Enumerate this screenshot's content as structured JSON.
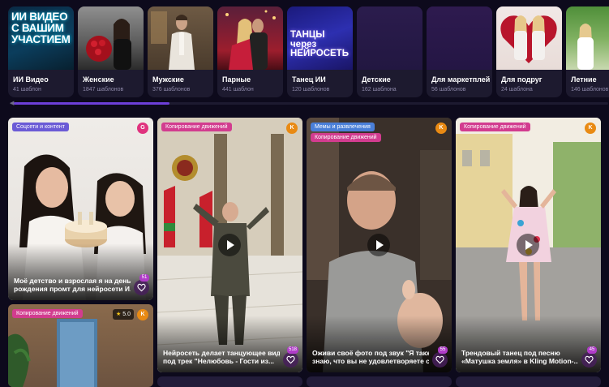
{
  "categories": [
    {
      "title": "ИИ Видео",
      "count": "41 шаблон",
      "thumb_text": "ИИ ВИДЕО С ВАШИМ УЧАСТИЕМ"
    },
    {
      "title": "Женские",
      "count": "1847 шаблонов"
    },
    {
      "title": "Мужские",
      "count": "376 шаблонов"
    },
    {
      "title": "Парные",
      "count": "441 шаблон"
    },
    {
      "title": "Танец ИИ",
      "count": "120 шаблонов",
      "thumb_text": "ТАНЦЫ через НЕЙРОСЕТЬ"
    },
    {
      "title": "Детские",
      "count": "162 шаблона"
    },
    {
      "title": "Для маркетплейсов",
      "count": "56 шаблонов"
    },
    {
      "title": "Для подруг",
      "count": "24 шаблона"
    },
    {
      "title": "Летние",
      "count": "146 шаблонов"
    }
  ],
  "templates": [
    {
      "tags": [
        "Соцсети и контент"
      ],
      "avatar": "G",
      "caption_1": "Моё детство и взрослая я на день",
      "caption_2": "рождения промт для нейросети И...",
      "likes": "51"
    },
    {
      "tags": [
        "Копирование движений"
      ],
      "avatar": "K",
      "caption_1": "Нейросеть делает танцующее видео",
      "caption_2": "под трек \"Нелюбовь - Гости из...",
      "likes": "518"
    },
    {
      "tags": [
        "Мемы и развлечения",
        "Копирование движений"
      ],
      "avatar": "K",
      "caption_1": "Оживи своё фото под звук \"Я также",
      "caption_2": "знаю, что вы не удовлетворяете св...",
      "likes": "55"
    },
    {
      "tags": [
        "Копирование движений"
      ],
      "avatar": "K",
      "caption_1": "Трендовый танец под песню",
      "caption_2": "«Матушка земля» в Kling Motion-...",
      "likes": "45"
    },
    {
      "tags": [
        "Копирование движений"
      ],
      "avatar": "K",
      "rating": "5.0"
    }
  ],
  "colors": {
    "background": "#0d0a1c",
    "card": "#1d1a2f",
    "accent": "#6d3fd9",
    "tag_pink": "#d23c8f",
    "tag_violet": "#6b5bd6"
  }
}
